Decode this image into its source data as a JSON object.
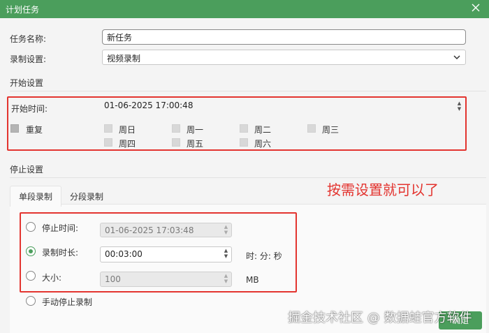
{
  "window": {
    "title": "计划任务"
  },
  "task_name": {
    "label": "任务名称:",
    "value": "新任务"
  },
  "record_setting": {
    "label": "录制设置:",
    "value": "视频录制"
  },
  "start_settings": {
    "section_title": "开始设置",
    "start_time_label": "开始时间:",
    "start_time_value": "01-06-2025 17:00:48",
    "repeat_label": "重复",
    "days": [
      "周日",
      "周一",
      "周二",
      "周三",
      "周四",
      "周五",
      "周六"
    ]
  },
  "stop_settings": {
    "section_title": "停止设置",
    "tabs": [
      "单段录制",
      "分段录制"
    ],
    "stop_time_label": "停止时间:",
    "stop_time_value": "01-06-2025 17:03:48",
    "duration_label": "录制时长:",
    "duration_value": "00:03:00",
    "duration_unit": "时: 分: 秒",
    "size_label": "大小:",
    "size_value": "100",
    "size_unit": "MB",
    "manual_stop_label": "手动停止录制",
    "selected": "duration"
  },
  "annotation": "按需设置就可以了",
  "ok_button": "确定",
  "watermark": "掘金技术社区 @ 数据蛙官方软件",
  "colors": {
    "accent": "#4b9e5c",
    "highlight": "#e3342f"
  }
}
